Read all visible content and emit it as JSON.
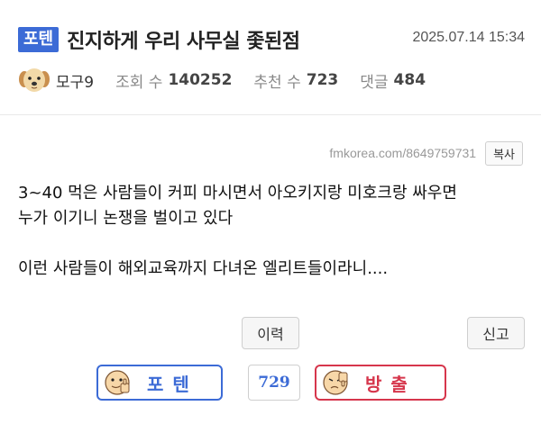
{
  "post": {
    "badge": "포텐",
    "title": "진지하게 우리 사무실 좇된점",
    "datetime": "2025.07.14 15:34"
  },
  "meta": {
    "author": "모구9",
    "views_label": "조회 수",
    "views": "140252",
    "recommend_label": "추천 수",
    "recommend": "723",
    "comments_label": "댓글",
    "comments": "484"
  },
  "share": {
    "url": "fmkorea.com/8649759731",
    "copy_label": "복사"
  },
  "content": {
    "line1": "3~40 먹은 사람들이 커피 마시면서 아오키지랑 미호크랑 싸우면",
    "line2": "누가 이기니 논쟁을 벌이고 있다",
    "line3": "이런 사람들이 해외교육까지 다녀온 엘리트들이라니...."
  },
  "actions": {
    "history_label": "이력",
    "report_label": "신고"
  },
  "vote": {
    "up_label": "포텐",
    "count": "729",
    "down_label": "방출"
  },
  "colors": {
    "accent_blue": "#3c6bd6",
    "accent_red": "#d6364c"
  },
  "icons": {
    "avatar": "puppy-avatar-icon",
    "vote_up": "thumbs-up-face-icon",
    "vote_down": "thumbs-down-face-icon"
  }
}
